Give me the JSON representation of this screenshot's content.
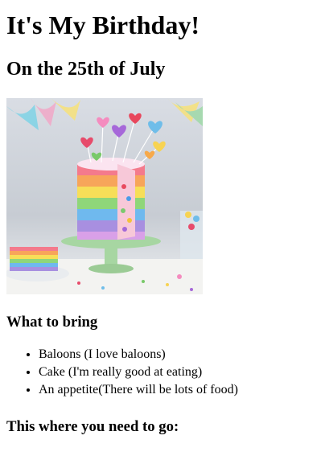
{
  "page": {
    "title": "It's My Birthday!",
    "date_heading": "On the 25th of July",
    "cake_image": {
      "kind": "rainbow layer cake photo"
    },
    "bring_heading": "What to bring",
    "bring_items": [
      "Baloons (I love baloons)",
      "Cake (I'm really good at eating)",
      "An appetite(There will be lots of food)"
    ],
    "directions_heading": "This where you need to go:"
  }
}
